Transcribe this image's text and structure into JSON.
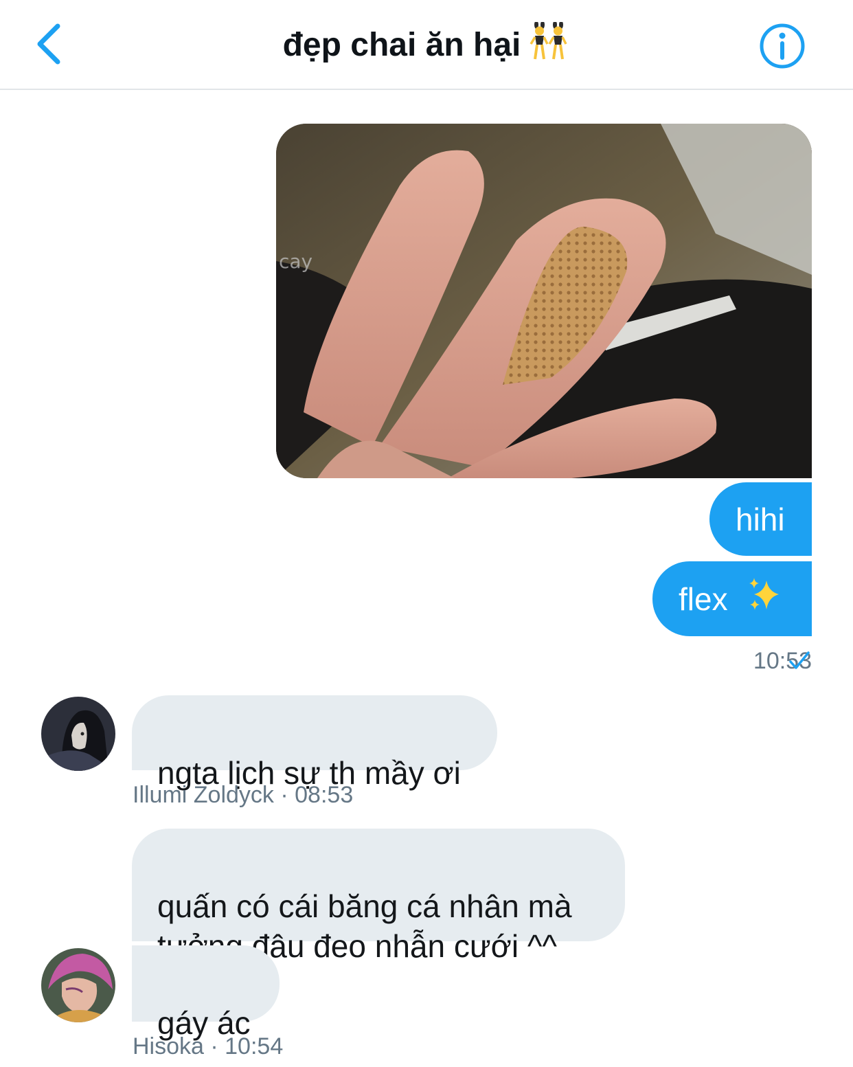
{
  "header": {
    "title": "đẹp chai ăn hại",
    "title_emoji": "dancers-emoji",
    "back_icon": "chevron-left-icon",
    "info_icon": "info-icon"
  },
  "colors": {
    "accent": "#1da1f2",
    "incoming_bubble": "#e6ecf0",
    "meta_text": "#657786"
  },
  "outgoing": {
    "messages": [
      "hihi",
      "flex "
    ],
    "flex_emoji": "sparkles-emoji",
    "time": "10:53",
    "status_icon": "checkmark-icon"
  },
  "incoming": {
    "group1": {
      "messages": [
        "ngta lịch sự th mầy ơi"
      ],
      "meta": "Illumi Zoldyck · 08:53"
    },
    "group2": {
      "messages": [
        "quấn có cái băng cá nhân mà\ntưởng đâu đeo nhẫn cưới ^^",
        "gáy ác"
      ],
      "meta": "Hisoka · 10:54"
    }
  }
}
